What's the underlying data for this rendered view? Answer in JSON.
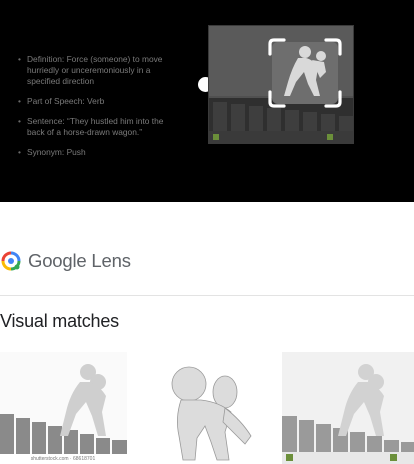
{
  "preview": {
    "bullets": [
      "Definition: Force (someone) to move hurriedly or unceremoniously in a specified direction",
      "Part of Speech: Verb",
      "Sentence: “They hustled him into the back of a horse-drawn wagon.”",
      "Synonym: Push"
    ]
  },
  "lens": {
    "brand_google": "Google",
    "brand_lens": "Lens"
  },
  "results": {
    "title": "Visual matches",
    "items": [
      {
        "caption": "shutterstock.com · 68618701",
        "icon": "pushing-figure-image"
      },
      {
        "caption": "",
        "icon": "figure-image"
      },
      {
        "caption": "",
        "icon": "pushing-figure-image"
      }
    ]
  },
  "colors": {
    "lens_blue": "#4285F4",
    "lens_red": "#EA4335",
    "lens_yellow": "#FBBC05",
    "lens_green": "#34A853"
  }
}
